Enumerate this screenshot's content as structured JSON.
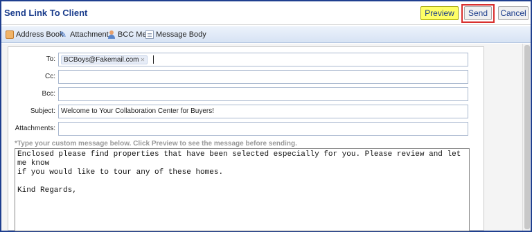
{
  "header": {
    "title": "Send Link To Client",
    "preview_label": "Preview",
    "send_label": "Send",
    "cancel_label": "Cancel"
  },
  "toolbar": {
    "address_book": "Address Book",
    "attachment": "Attachment",
    "bcc_me": "BCC Me",
    "message_body": "Message Body"
  },
  "form": {
    "to_label": "To:",
    "to_recipient": "BCBoys@Fakemail.com",
    "cc_label": "Cc:",
    "cc_value": "",
    "bcc_label": "Bcc:",
    "bcc_value": "",
    "subject_label": "Subject:",
    "subject_value": "Welcome to Your Collaboration Center for Buyers!",
    "attachments_label": "Attachments:",
    "attachments_value": ""
  },
  "message": {
    "instructions": "*Type your custom message below. Click Preview to see the message before sending.",
    "body": "Enclosed please find properties that have been selected especially for you. Please review and let me know\nif you would like to tour any of these homes.\n\nKind Regards,"
  },
  "colors": {
    "title": "#1a3c8c",
    "preview_bg": "#ffff66",
    "send_highlight": "#d9302e",
    "frame": "#1f3f8f"
  },
  "icons": [
    "address-book-icon",
    "attachment-icon",
    "bcc-me-icon",
    "message-body-icon",
    "remove-recipient-icon"
  ]
}
